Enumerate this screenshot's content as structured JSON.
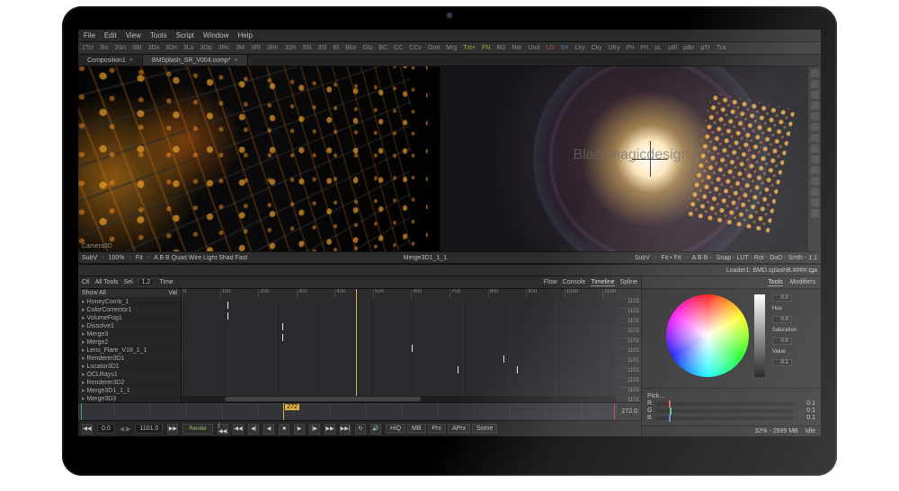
{
  "menu": [
    "File",
    "Edit",
    "View",
    "Tools",
    "Script",
    "Window",
    "Help"
  ],
  "toolbar": {
    "items": [
      "1Tct",
      "3In",
      "3Sn",
      "3BI",
      "3Ds",
      "3Dn",
      "3Lo",
      "3Op",
      "3Rc",
      "3M",
      "3Rf",
      "3Rn",
      "3Sh",
      "3Si",
      "3Sl",
      "BI",
      "Blur",
      "Glo",
      "BC",
      "CC",
      "CCv",
      "Gmt",
      "Mrg",
      "Txt+",
      "FN",
      "BG",
      "Nte",
      "Und",
      "LD",
      "SV",
      "Lky",
      "Cky",
      "UKy",
      "Pri",
      "Prt",
      "pL",
      "pBl",
      "pBn",
      "pTr",
      "Tra"
    ]
  },
  "tabs": [
    {
      "label": "Composition1",
      "active": false
    },
    {
      "label": "BMSplash_SR_V004.comp*",
      "active": true
    }
  ],
  "viewer1": {
    "label_left": "SubV",
    "zoom": "100%",
    "fit": "Fit",
    "btns": [
      "A",
      "B",
      "B",
      "Quad",
      "Wire",
      "Light",
      "Shad",
      "Fast"
    ],
    "title": "Merge3D1_1_1",
    "camera": "Camera3D"
  },
  "viewer2": {
    "brand": "Blackmagicdesign",
    "label_left": "SubV",
    "fit": "Fit • Fit",
    "btns": [
      "A",
      "B",
      "B"
    ],
    "btns2": [
      "Snap",
      "LUT",
      "RoI",
      "DoD",
      "Smth",
      "1:1"
    ],
    "loader": "Loader1: BMD.splashB.####.tga"
  },
  "spline": {
    "ctl": "Ctl",
    "alltools": "All Tools",
    "sel": "Sel",
    "time_label": "Time",
    "time_field": "1,2",
    "tabs_right": [
      "Flow",
      "Console",
      "Timeline",
      "Spline"
    ],
    "tabs_sel": "Timeline",
    "hdr_left": "Show All",
    "hdr_right": "Val",
    "layers": [
      "HoneyComb_1",
      "ColorCorrector1",
      "VolumeFog1",
      "Dissolve1",
      "Merge3",
      "Merge2",
      "Lens_Flare_V18_1_1",
      "Renderer3D1",
      "Locator3D1",
      "OCLRays1",
      "Renderer3D2",
      "Merge3D1_1_1",
      "Merge3D3"
    ],
    "ruler_ticks": [
      "0",
      "100",
      "200",
      "300",
      "400",
      "500",
      "600",
      "700",
      "800",
      "900",
      "1000",
      "1100"
    ],
    "vals": [
      "1101",
      "1101",
      "1101",
      "1101",
      "1101",
      "1101",
      "1101",
      "1101",
      "1101",
      "1101",
      "1101",
      "1101",
      "1101"
    ]
  },
  "timebar": {
    "playhead": "272",
    "end": "272.0"
  },
  "transport": {
    "in": "0.0",
    "out": "1101.0",
    "render": "Render",
    "chips": [
      "HiQ",
      "MB",
      "Prx",
      "APrx",
      "Some"
    ],
    "arrows": "◀◀"
  },
  "inspector": {
    "tabs": [
      "Tools",
      "Modifiers"
    ],
    "tabs_sel": "Tools",
    "hue": {
      "label": "Hue",
      "val": "0.0"
    },
    "sat": {
      "label": "Saturation",
      "val": "0.0"
    },
    "valv": {
      "label": "Value",
      "val": "0.1"
    },
    "top_val": "0.0",
    "pick": "Pick…",
    "rgb": {
      "r": "0.1",
      "g": "0.1",
      "b": "0.1"
    }
  },
  "status": {
    "mem": "32% - 2599 MB",
    "state": "Idle"
  }
}
